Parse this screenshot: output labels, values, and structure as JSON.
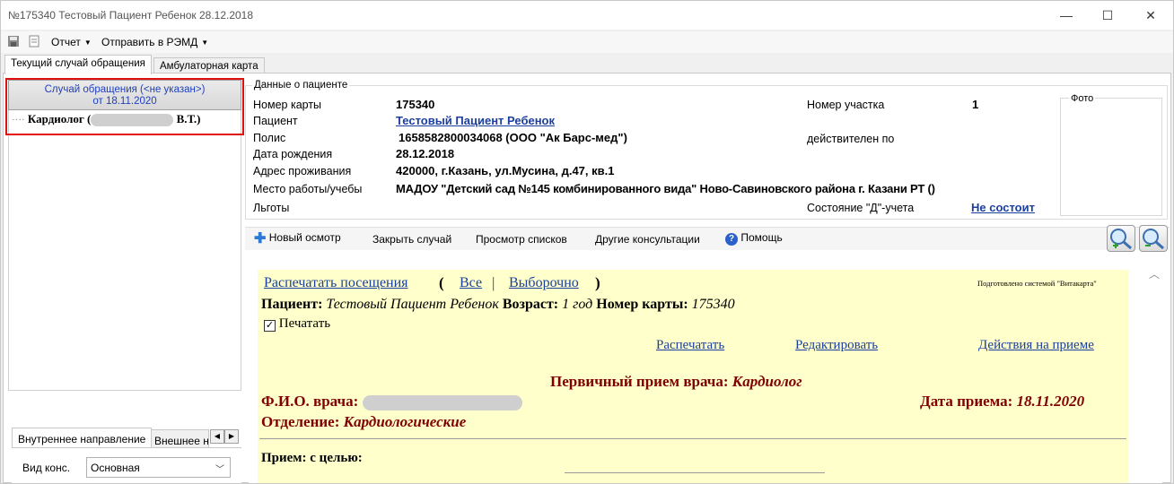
{
  "window": {
    "title": "№175340 Тестовый Пациент Ребенок 28.12.2018",
    "minimize_glyph": "—",
    "maximize_glyph": "☐",
    "close_glyph": "✕"
  },
  "menu": {
    "save_icon": "save-icon",
    "print_icon": "print-icon",
    "report_label": "Отчет",
    "send_label": "Отправить в РЭМД"
  },
  "tabs": {
    "current_case": "Текущий случай обращения",
    "outpatient_card": "Амбулаторная карта"
  },
  "left": {
    "case_title": "Случай обращения (<не указан>)",
    "case_date": "от 18.11.2020",
    "doctor_prefix": "Кардиолог (",
    "doctor_suffix": "В.Т.)",
    "subtab_internal": "Внутреннее направление",
    "subtab_external": "Внешнее на",
    "arrow_left": "◀",
    "arrow_right": "▶",
    "consult_type_label": "Вид конс.",
    "consult_type_value": "Основная"
  },
  "patient": {
    "group_title": "Данные о пациенте",
    "card_no_label": "Номер карты",
    "card_no": "175340",
    "patient_label": "Пациент",
    "patient_name": "Тестовый Пациент Ребенок",
    "policy_label": "Полис",
    "policy": "1658582800034068 (ООО \"Ак Барс-мед\")",
    "dob_label": "Дата рождения",
    "dob": "28.12.2018",
    "address_label": "Адрес проживания",
    "address": "420000, г.Казань, ул.Мусина, д.47, кв.1",
    "work_label": "Место работы/учебы",
    "work": "МАДОУ \"Детский сад №145 комбинированного вида\" Ново-Савиновского района г. Казани РТ ()",
    "benefits_label": "Льготы",
    "district_label": "Номер участка",
    "district": "1",
    "valid_label": "действителен по",
    "d_status_label": "Состояние \"Д\"-учета",
    "d_status": "Не состоит",
    "photo_label": "Фото"
  },
  "toolbar": {
    "new_exam": "Новый осмотр",
    "close_case": "Закрыть случай",
    "view_lists": "Просмотр списков",
    "other_consults": "Другие консультации",
    "help": "Помощь"
  },
  "doc": {
    "print_visits": "Распечатать посещения",
    "open_paren": "(",
    "all": "Все",
    "sep": "|",
    "selective": "Выборочно",
    "close_paren": ")",
    "prepared_by": "Подготовлено системой \"Витакарта\"",
    "patient_label": "Пациент:",
    "patient_name": "Тестовый Пациент Ребенок",
    "age_label": "Возраст:",
    "age": "1 год",
    "card_label": "Номер карты:",
    "card_no": "175340",
    "print_check": "Печатать",
    "print_link": "Распечатать",
    "edit_link": "Редактировать",
    "actions_link": "Действия на приеме",
    "visit_title": "Первичный прием врача:",
    "visit_spec": "Кардиолог",
    "doctor_label": "Ф.И.О. врача:",
    "visit_date_label": "Дата приема:",
    "visit_date": "18.11.2020",
    "department_label": "Отделение:",
    "department": "Кардиологические",
    "purpose_label": "Прием: с целью:"
  }
}
